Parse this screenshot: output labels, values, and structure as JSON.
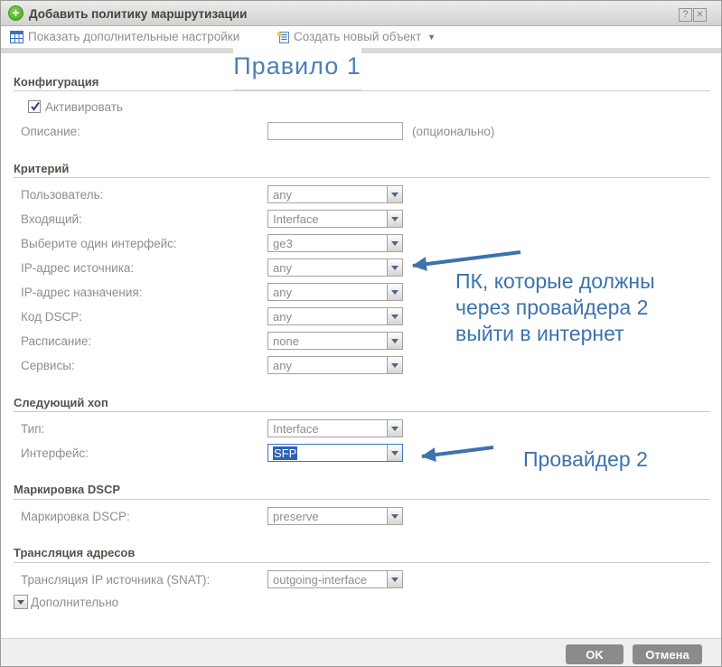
{
  "colors": {
    "annotation_blue": "#3c73ad",
    "plus_green": "#56b62c",
    "selection_blue": "#2f62b5",
    "button_gray": "#8b8b89"
  },
  "titlebar": {
    "title": "Добавить политику маршрутизации",
    "help_label": "?",
    "close_label": "✕"
  },
  "toolbar": {
    "show_advanced_label": "Показать дополнительные настройки",
    "create_object_label": "Создать новый объект",
    "caret": "▼"
  },
  "overlay": {
    "rule_label": "Правило 1",
    "note_pc_line1": "ПК, которые должны",
    "note_pc_line2": "через провайдера 2",
    "note_pc_line3": "выйти в интернет",
    "note_provider": "Провайдер 2"
  },
  "config": {
    "section_title": "Конфигурация",
    "enable_label": "Активировать",
    "enable_checked": true,
    "description_label": "Описание:",
    "description_value": "",
    "optional_hint": "(опционально)"
  },
  "criteria": {
    "section_title": "Критерий",
    "rows": [
      {
        "label": "Пользователь:",
        "value": "any"
      },
      {
        "label": "Входящий:",
        "value": "Interface"
      },
      {
        "label": "Выберите один интерфейс:",
        "value": "ge3"
      },
      {
        "label": "IP-адрес источника:",
        "value": "any"
      },
      {
        "label": "IP-адрес назначения:",
        "value": "any"
      },
      {
        "label": "Код DSCP:",
        "value": "any"
      },
      {
        "label": "Расписание:",
        "value": "none"
      },
      {
        "label": "Сервисы:",
        "value": "any"
      }
    ]
  },
  "next_hop": {
    "section_title": "Следующий хоп",
    "rows": [
      {
        "label": "Тип:",
        "value": "Interface"
      },
      {
        "label": "Интерфейс:",
        "value": "SFP",
        "focused": true
      }
    ]
  },
  "dscp": {
    "section_title": "Маркировка DSCP",
    "rows": [
      {
        "label": "Маркировка DSCP:",
        "value": "preserve"
      }
    ]
  },
  "snat": {
    "section_title": "Трансляция адресов",
    "rows": [
      {
        "label": "Трансляция IP источника (SNAT):",
        "value": "outgoing-interface"
      }
    ],
    "advanced_label": "Дополнительно"
  },
  "footer": {
    "ok_label": "OK",
    "cancel_label": "Отмена"
  }
}
